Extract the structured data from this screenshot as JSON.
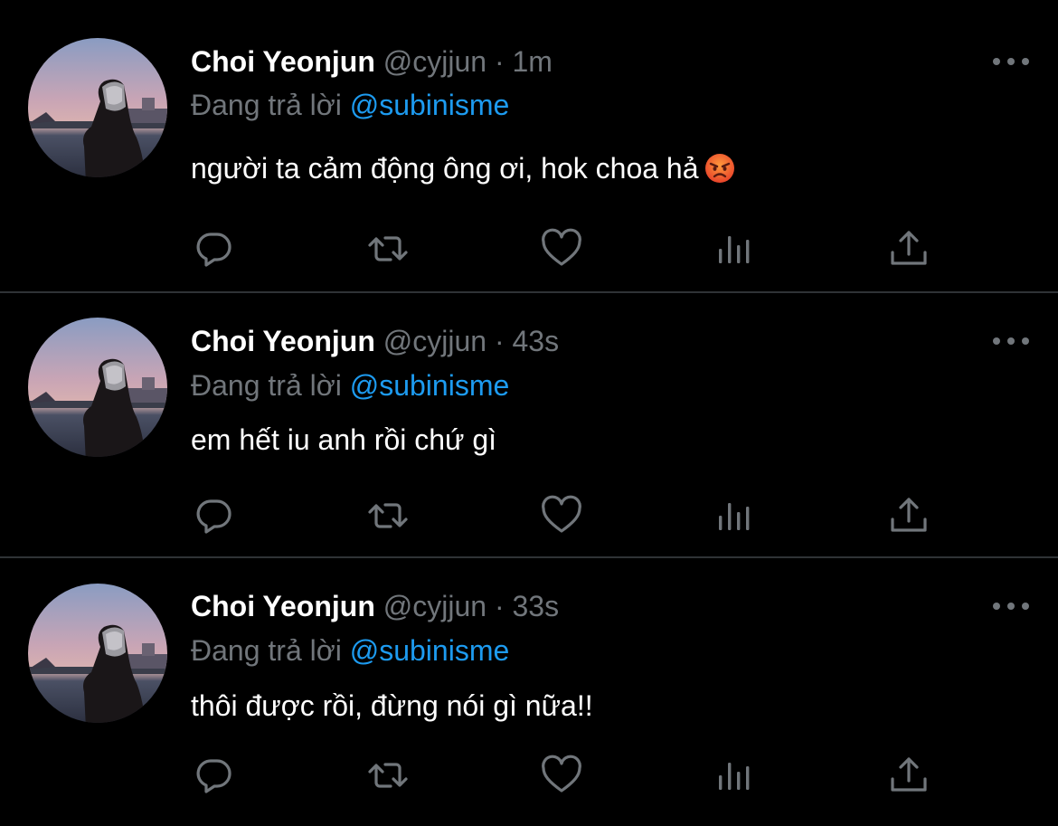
{
  "tweets": [
    {
      "name": "Choi Yeonjun",
      "handle": "@cyjjun",
      "separator": "·",
      "time": "1m",
      "reply_prefix": "Đang trả lời",
      "reply_to": "@subinisme",
      "text": "người ta cảm động ông ơi, hok choa hả",
      "emoji": "angry-face-icon"
    },
    {
      "name": "Choi Yeonjun",
      "handle": "@cyjjun",
      "separator": "·",
      "time": "43s",
      "reply_prefix": "Đang trả lời",
      "reply_to": "@subinisme",
      "text": "em hết iu anh rồi chứ gì"
    },
    {
      "name": "Choi Yeonjun",
      "handle": "@cyjjun",
      "separator": "·",
      "time": "33s",
      "reply_prefix": "Đang trả lời",
      "reply_to": "@subinisme",
      "text": "thôi được rồi, đừng nói gì nữa!!"
    }
  ],
  "actions": [
    "reply-icon",
    "retweet-icon",
    "like-icon",
    "views-icon",
    "share-icon"
  ],
  "colors": {
    "background": "#000000",
    "divider": "#2f3336",
    "secondary_text": "#71767b",
    "link": "#1d9bf0",
    "primary_text": "#ffffff"
  }
}
